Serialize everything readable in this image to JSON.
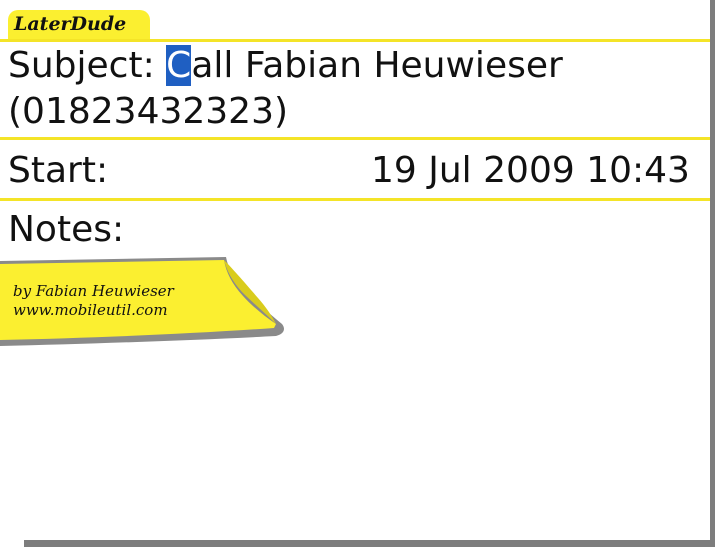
{
  "app": {
    "title": "LaterDude"
  },
  "task": {
    "subject_label": "Subject:",
    "subject_cursor_char": "C",
    "subject_rest_line1": "all Fabian Heuwieser",
    "subject_line2": "(01823432323)",
    "start_label": "Start:",
    "start_value": "19 Jul 2009 10:43",
    "notes_label": "Notes:"
  },
  "sticky_note": {
    "line1": "by Fabian Heuwieser",
    "line2": "www.mobileutil.com"
  },
  "colors": {
    "accent_yellow": "#fbef30",
    "rule_yellow": "#f4e428",
    "cursor_blue": "#1f5fc2",
    "device_edge": "#7d7d7d"
  },
  "icons": {
    "sticky_note": "sticky-note-icon"
  }
}
